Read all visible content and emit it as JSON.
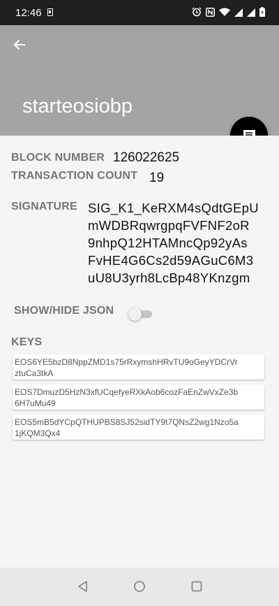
{
  "status_bar": {
    "time": "12:46",
    "icons": [
      "sim-card-icon",
      "alarm-icon",
      "nfc-icon",
      "wifi-icon",
      "signal-icon",
      "signal-icon",
      "battery-icon"
    ]
  },
  "app_bar": {
    "title": "starteosiobp",
    "background": "#a4a4a4",
    "back_icon": "arrow-left-icon"
  },
  "fab": {
    "icon": "message-icon",
    "color": "#000000"
  },
  "details": {
    "block_number_label": "BLOCK NUMBER",
    "block_number": "126022625",
    "transaction_count_label": "TRANSACTION COUNT",
    "transaction_count": "19",
    "signature_label": "SIGNATURE",
    "signature_lines": [
      "SIG_K1_KeRXM4sQdtGEpU",
      "mWDBRqwrgpqFVFNF2oR",
      "9nhpQ12HTAMncQp92yAs",
      "FvHE4G6Cs2d59AGuC6M3",
      "uU8U3yrh8LcBp48YKnzgm"
    ],
    "toggle_label": "SHOW/HIDE JSON",
    "toggle_on": false
  },
  "keys": {
    "label": "KEYS",
    "items": [
      [
        "EOS6YE5bzD8NppZMD1s75rRxymshHRvTU9oGeyYDCrVr",
        "ztuCa3tkA"
      ],
      [
        "EOS7DmuzD5HzN3xfUCqefyeRXkAob6cozFaEnZwVxZe3b",
        "6H7uMu49"
      ],
      [
        "EOS5mB5dYCpQTHUPBS8SJ52sidTY9t7QNsZ2wg1Nzo5a",
        "1jKQM3Qx4"
      ]
    ]
  },
  "nav_bar": {
    "buttons": [
      "back-triangle-icon",
      "home-circle-icon",
      "recents-square-icon"
    ]
  }
}
